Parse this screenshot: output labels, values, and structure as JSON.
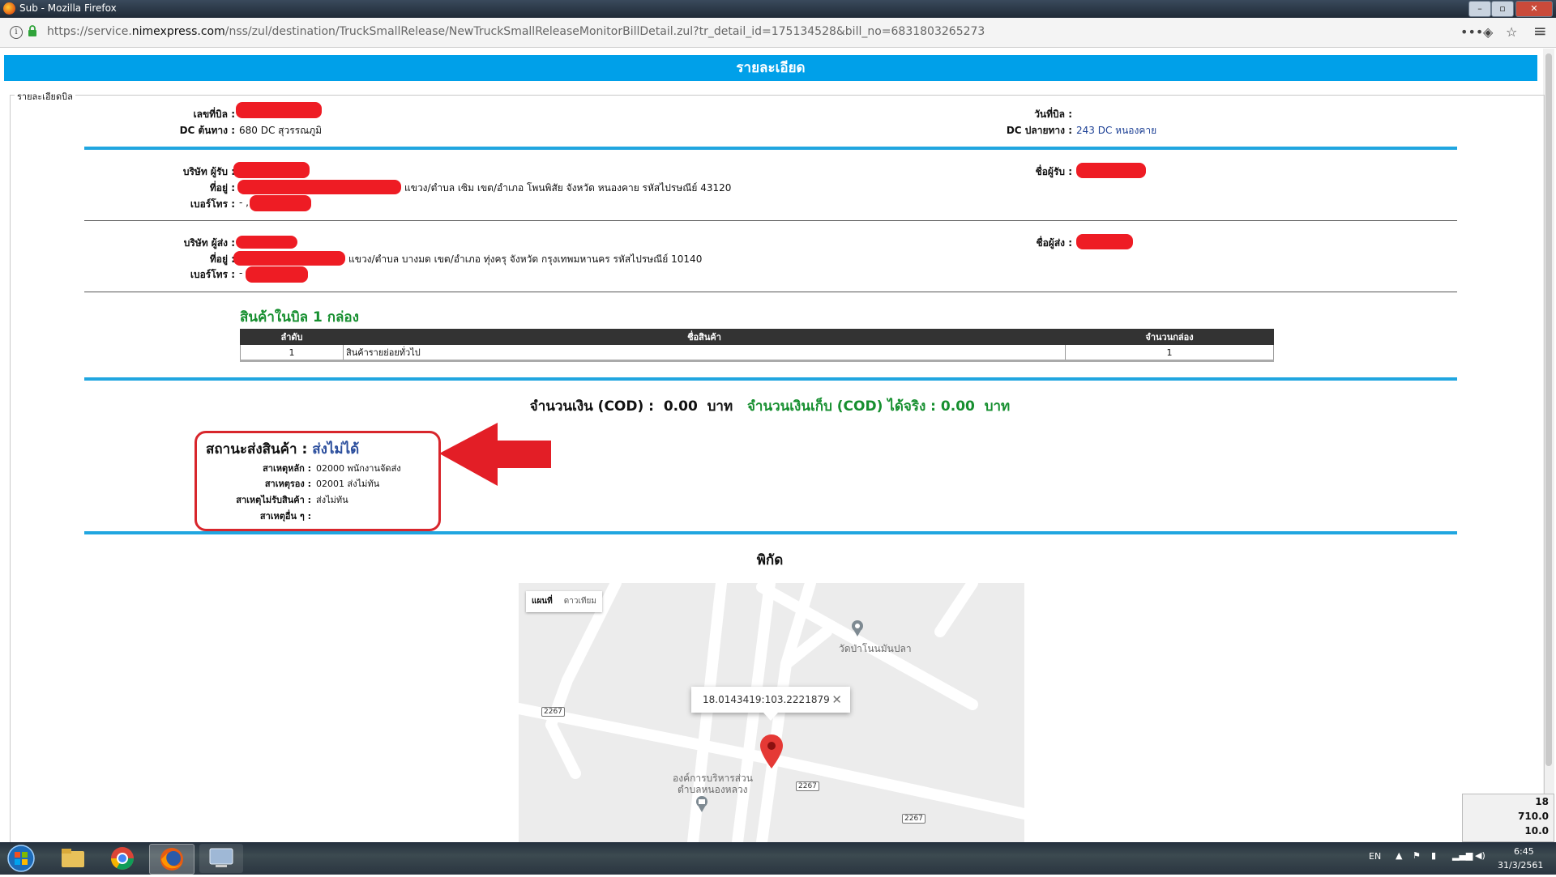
{
  "window": {
    "title": "Sub - Mozilla Firefox",
    "url_prefix": "https://service.",
    "url_domain": "nimexpress.com",
    "url_path": "/nss/zul/destination/TruckSmallRelease/NewTruckSmallReleaseMonitorBillDetail.zul?tr_detail_id=175134528&bill_no=6831803265273",
    "menu_glyph": "•••",
    "pocket_glyph": "◈",
    "star_glyph": "☆",
    "hamburger_glyph": "≡"
  },
  "page": {
    "header": "รายละเอียด",
    "legend": "รายละเอียดบิล"
  },
  "bill": {
    "bill_no_label": "เลขที่บิล :",
    "origin_dc_label": "DC ต้นทาง :",
    "origin_dc_value": "680 DC สุวรรณภูมิ",
    "bill_date_label": "วันที่บิล :",
    "dest_dc_label": "DC ปลายทาง :",
    "dest_dc_value": "243 DC หนองคาย"
  },
  "receiver": {
    "company_label": "บริษัท ผู้รับ :",
    "address_label": "ที่อยู่ :",
    "address_value": "แขวง/ตำบล เซิม เขต/อำเภอ โพนพิสัย จังหวัด หนองคาย รหัสไปรษณีย์ 43120",
    "phone_label": "เบอร์โทร :",
    "phone_value": "- ,",
    "name_label": "ชื่อผู้รับ :"
  },
  "sender": {
    "company_label": "บริษัท ผู้ส่ง :",
    "address_label": "ที่อยู่ :",
    "address_value": "แขวง/ตำบล บางมด เขต/อำเภอ ทุ่งครุ จังหวัด กรุงเทพมหานคร รหัสไปรษณีย์ 10140",
    "phone_label": "เบอร์โทร :",
    "phone_value": "-",
    "name_label": "ชื่อผู้ส่ง :"
  },
  "items": {
    "title": "สินค้าในบิล  1  กล่อง",
    "headers": [
      "ลำดับ",
      "ชื่อสินค้า",
      "จำนวนกล่อง"
    ],
    "rows": [
      [
        "1",
        "สินค้ารายย่อยทั่วไป",
        "1"
      ]
    ]
  },
  "cod": {
    "amount_label": "จำนวนเงิน (COD) :",
    "amount_value": "0.00",
    "amount_unit": "บาท",
    "collected_label": "จำนวนเงินเก็บ (COD) ได้จริง :",
    "collected_value": "0.00",
    "collected_unit": "บาท"
  },
  "status": {
    "label": "สถานะส่งสินค้า :",
    "value": "ส่งไม่ได้",
    "reasons": [
      {
        "label": "สาเหตุหลัก :",
        "value": "02000  พนักงานจัดส่ง"
      },
      {
        "label": "สาเหตุรอง :",
        "value": "02001 ส่งไม่ทัน"
      },
      {
        "label": "สาเหตุไม่รับสินค้า :",
        "value": "ส่งไม่ทัน"
      },
      {
        "label": "สาเหตุอื่น ๆ :",
        "value": ""
      }
    ],
    "arrow_color": "#e31e26"
  },
  "location": {
    "title": "พิกัด",
    "map_tabs": [
      "แผนที่",
      "ดาวเทียม"
    ],
    "coordinates": "18.0143419:103.2221879",
    "close_glyph": "✕",
    "poi_temple": "วัดป่าโนนมันปลา",
    "poi_office_line1": "องค์การบริหารส่วน",
    "poi_office_line2": "ตำบลหนองหลวง",
    "road_shields": [
      "2267",
      "2267",
      "2267"
    ]
  },
  "taskbar": {
    "lang": "EN",
    "time": "6:45",
    "date": "31/3/2561",
    "meter_values": [
      "18",
      "710.0",
      "10.0"
    ]
  },
  "colors": {
    "header_blue": "#00a0e9",
    "divider_blue": "#20a6e0",
    "green_text": "#168f2f",
    "status_blue": "#2a4d9c",
    "redaction_red": "#ee1c24"
  }
}
